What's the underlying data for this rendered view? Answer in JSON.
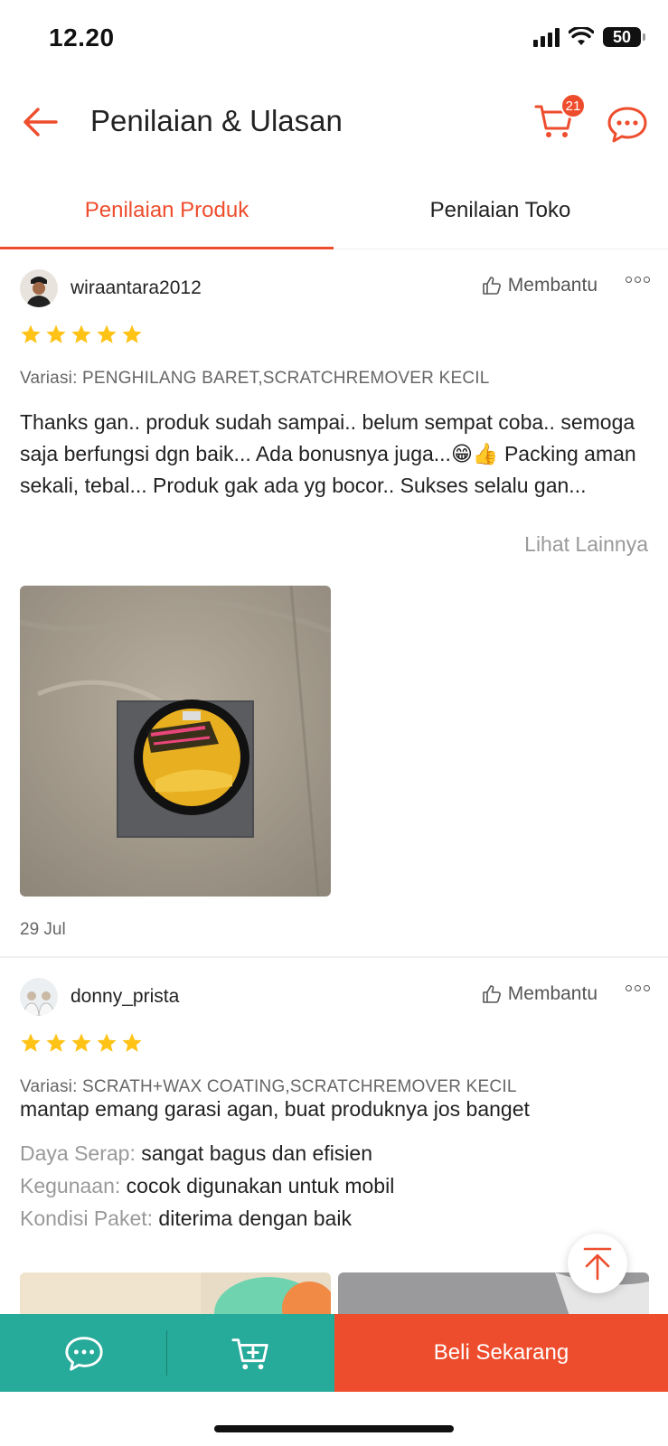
{
  "status_bar": {
    "time": "12.20",
    "battery": "50"
  },
  "header": {
    "title": "Penilaian & Ulasan",
    "cart_count": "21",
    "back_icon": "back-arrow-icon",
    "cart_icon": "shopping-cart-icon",
    "chat_icon": "chat-bubble-icon",
    "accent_color": "#ee4d2d"
  },
  "tabs": [
    {
      "label": "Penilaian Produk",
      "active": true
    },
    {
      "label": "Penilaian Toko",
      "active": false
    }
  ],
  "reviews": [
    {
      "username": "wiraantara2012",
      "helpful_label": "Membantu",
      "rating": 5,
      "variation": "Variasi: PENGHILANG BARET,SCRATCHREMOVER KECIL",
      "text": "Thanks gan.. produk sudah sampai.. belum sempat coba.. semoga saja berfungsi dgn baik... Ada bonusnya juga...😁👍 Packing aman sekali, tebal... Produk gak ada yg bocor.. Sukses selalu gan...",
      "see_more": "Lihat Lainnya",
      "date": "29 Jul"
    },
    {
      "username": "donny_prista",
      "helpful_label": "Membantu",
      "rating": 5,
      "variation": "Variasi: SCRATH+WAX COATING,SCRATCHREMOVER KECIL",
      "text": "mantap emang garasi agan, buat produknya jos banget",
      "attributes": [
        {
          "key": "Daya Serap:",
          "value": "sangat bagus dan efisien"
        },
        {
          "key": "Kegunaan:",
          "value": "cocok digunakan untuk mobil"
        },
        {
          "key": "Kondisi Paket:",
          "value": "diterima dengan baik"
        }
      ]
    }
  ],
  "bottom_bar": {
    "buy_label": "Beli Sekarang",
    "chat_icon": "chat-bubble-icon",
    "add_cart_icon": "add-to-cart-icon",
    "chat_color": "#26aa99",
    "buy_color": "#ee4d2d"
  }
}
